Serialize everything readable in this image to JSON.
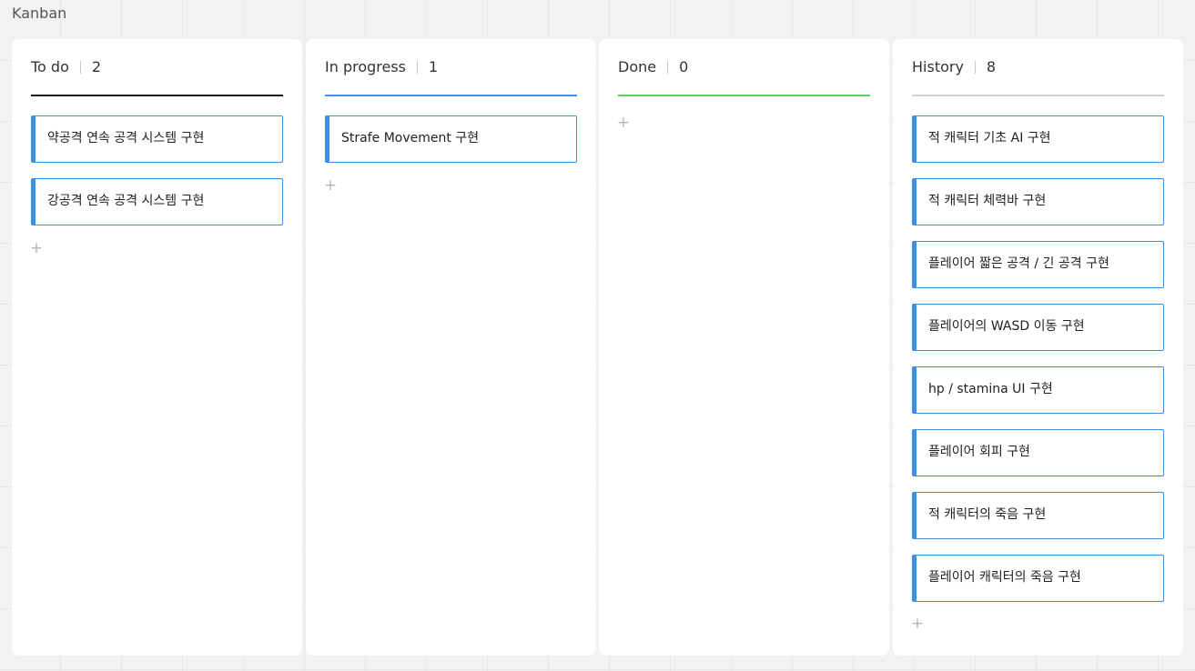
{
  "frame": {
    "title": "Kanban"
  },
  "add_symbol": "+",
  "columns": [
    {
      "title": "To do",
      "count": "2",
      "underline_color": "#1a1a1a",
      "cards": [
        "약공격 연속 공격 시스템 구현",
        "강공격 연속 공격 시스템 구현"
      ]
    },
    {
      "title": "In progress",
      "count": "1",
      "underline_color": "#4a8fe6",
      "cards": [
        "Strafe Movement 구현"
      ]
    },
    {
      "title": "Done",
      "count": "0",
      "underline_color": "#6cc96a",
      "cards": []
    },
    {
      "title": "History",
      "count": "8",
      "underline_color": "#d0d0d0",
      "cards": [
        "적 캐릭터 기초 AI 구현",
        "적 캐릭터 체력바 구현",
        "플레이어 짧은 공격 / 긴 공격 구현",
        "플레이어의 WASD 이동 구현",
        "hp / stamina UI 구현",
        "플레이어 회피 구현",
        "적 캐릭터의 죽음 구현",
        "플레이어 캐릭터의 죽음 구현"
      ]
    }
  ],
  "colors": {
    "card_accent": "#3d8fe0",
    "background": "#f2f2f2"
  }
}
